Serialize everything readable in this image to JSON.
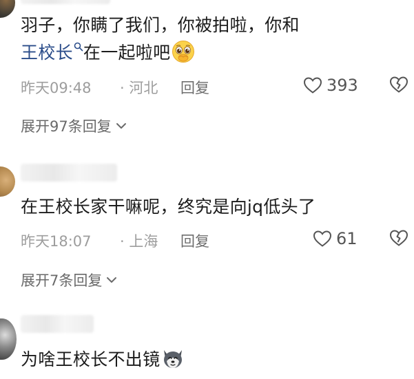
{
  "comments": [
    {
      "text_line1": "羽子，你瞒了我们，你被拍啦，你和",
      "mention": "王校长",
      "text_after_mention": "在一起啦吧",
      "emoji": "pleading-face-emoji",
      "time": "昨天09:48",
      "location": "· 河北",
      "reply_label": "回复",
      "likes": "393",
      "expand_label": "展开97条回复"
    },
    {
      "text": "在王校长家干嘛呢，终究是向jq低头了",
      "time": "昨天18:07",
      "location": "· 上海",
      "reply_label": "回复",
      "likes": "61",
      "expand_label": "展开7条回复"
    },
    {
      "text": "为啥王校长不出镜",
      "emoji": "husky-dog-emoji"
    }
  ],
  "colors": {
    "mention": "#2b4d8a",
    "meta": "#9d9d9d",
    "text": "#1c1c1c"
  }
}
